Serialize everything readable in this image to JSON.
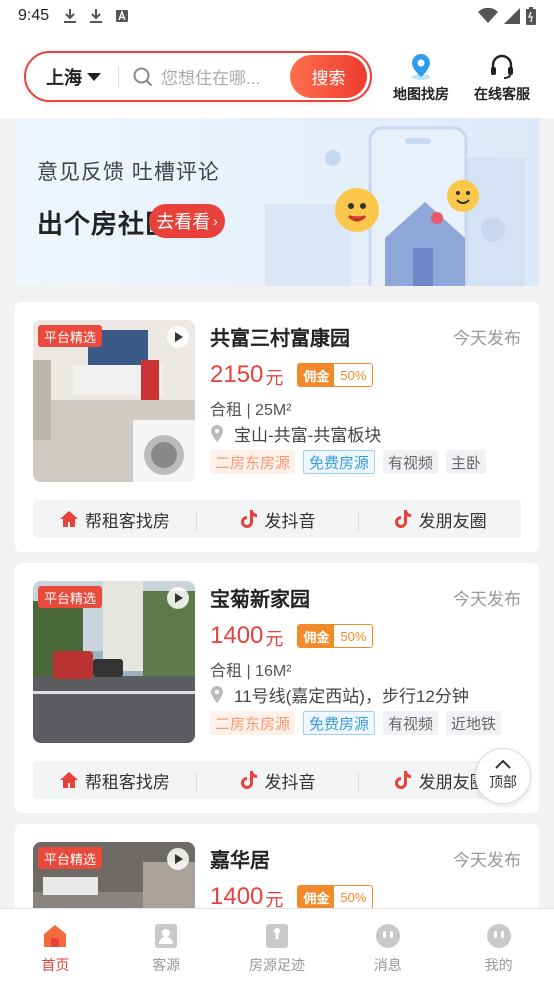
{
  "status_bar": {
    "time": "9:45"
  },
  "header": {
    "city": "上海",
    "search_placeholder": "您想住在哪...",
    "search_button": "搜索",
    "map_label": "地图找房",
    "service_label": "在线客服"
  },
  "banner": {
    "line1": "意见反馈 吐槽评论",
    "line2": "出个房社区",
    "button": "去看看"
  },
  "listings": [
    {
      "badge": "平台精选",
      "title": "共富三村富康园",
      "date": "今天发布",
      "price": "2150",
      "price_unit": "元",
      "commission_label": "佣金",
      "commission_value": "50%",
      "spec": "合租 | 25M²",
      "location": "宝山-共富-共富板块",
      "tags": [
        "二房东房源",
        "免费房源",
        "有视频",
        "主卧"
      ],
      "actions": [
        "帮租客找房",
        "发抖音",
        "发朋友圈"
      ]
    },
    {
      "badge": "平台精选",
      "title": "宝菊新家园",
      "date": "今天发布",
      "price": "1400",
      "price_unit": "元",
      "commission_label": "佣金",
      "commission_value": "50%",
      "spec": "合租 | 16M²",
      "location": "11号线(嘉定西站)，步行12分钟",
      "tags": [
        "二房东房源",
        "免费房源",
        "有视频",
        "近地铁"
      ],
      "actions": [
        "帮租客找房",
        "发抖音",
        "发朋友圈"
      ]
    },
    {
      "badge": "平台精选",
      "title": "嘉华居",
      "date": "今天发布",
      "price": "1400",
      "price_unit": "元",
      "commission_label": "佣金",
      "commission_value": "50%"
    }
  ],
  "back_to_top": "顶部",
  "bottom_nav": [
    "首页",
    "客源",
    "房源足迹",
    "消息",
    "我的"
  ],
  "colors": {
    "accent": "#e8413c",
    "commission": "#f28a2a",
    "tag_blue": "#3b9bd8"
  }
}
